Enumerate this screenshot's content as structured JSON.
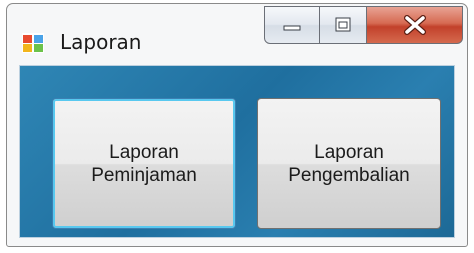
{
  "window": {
    "title": "Laporan",
    "icon": "windows-form-icon",
    "controls": {
      "minimize_icon": "minimize-icon",
      "maximize_icon": "maximize-icon",
      "close_icon": "close-icon"
    }
  },
  "buttons": [
    {
      "label": "Laporan\nPeminjaman",
      "focused": true
    },
    {
      "label": "Laporan\nPengembalian",
      "focused": false
    }
  ],
  "colors": {
    "panel_background": "#2a7fb0",
    "focus_glow": "#58c8ef",
    "close_button": "#c2412b"
  }
}
